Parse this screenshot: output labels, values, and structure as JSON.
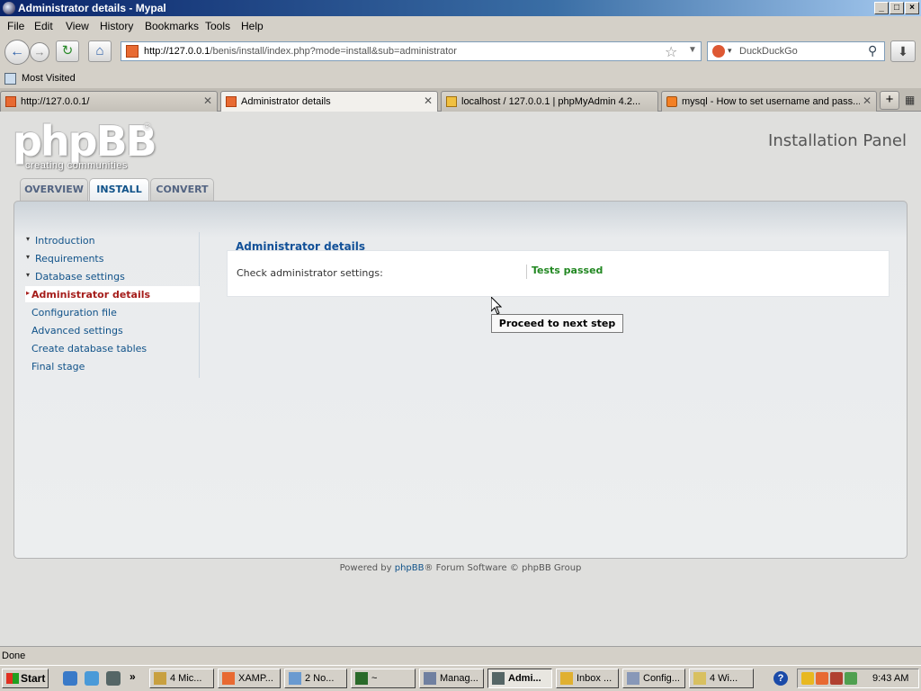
{
  "window": {
    "title": "Administrator details - Mypal"
  },
  "menubar": {
    "items": [
      "File",
      "Edit",
      "View",
      "History",
      "Bookmarks",
      "Tools",
      "Help"
    ]
  },
  "navbar": {
    "url_domain": "http://127.0.0.1",
    "url_path": "/benis/install/index.php?mode=install&sub=administrator",
    "search_placeholder": "DuckDuckGo"
  },
  "bookmarks": {
    "most_visited": "Most Visited"
  },
  "tabs": [
    {
      "label": "http://127.0.0.1/",
      "active": false
    },
    {
      "label": "Administrator details",
      "active": true
    },
    {
      "label": "localhost / 127.0.0.1 | phpMyAdmin 4.2...",
      "active": false
    },
    {
      "label": "mysql - How to set username and pass...",
      "active": false
    }
  ],
  "page": {
    "logo_text": "phpBB",
    "logo_registered": "®",
    "logo_tagline": "creating communities",
    "panel_title": "Installation Panel",
    "top_tabs": [
      "OVERVIEW",
      "INSTALL",
      "CONVERT"
    ],
    "active_top_tab": "INSTALL",
    "steps": [
      {
        "label": "Introduction",
        "state": "done"
      },
      {
        "label": "Requirements",
        "state": "done"
      },
      {
        "label": "Database settings",
        "state": "done"
      },
      {
        "label": "Administrator details",
        "state": "current"
      },
      {
        "label": "Configuration file",
        "state": "pending"
      },
      {
        "label": "Advanced settings",
        "state": "pending"
      },
      {
        "label": "Create database tables",
        "state": "pending"
      },
      {
        "label": "Final stage",
        "state": "pending"
      }
    ],
    "section_title": "Administrator details",
    "check_label": "Check administrator settings:",
    "check_result": "Tests passed",
    "proceed_button": "Proceed to next step",
    "footer_prefix": "Powered by ",
    "footer_link": "phpBB",
    "footer_suffix": "® Forum Software © phpBB Group"
  },
  "status": {
    "text": "Done"
  },
  "taskbar": {
    "start": "Start",
    "buttons": [
      "4 Mic...",
      "XAMP...",
      "2 No...",
      "~",
      "Manag...",
      "Admi...",
      "Inbox ...",
      "Config...",
      "4 Wi..."
    ],
    "active_button": "Admi...",
    "clock": "9:43 AM"
  },
  "colors": {
    "link": "#105289",
    "current_step": "#a51d1b",
    "tests_passed": "#228822",
    "title_bar": "#0a246a"
  }
}
